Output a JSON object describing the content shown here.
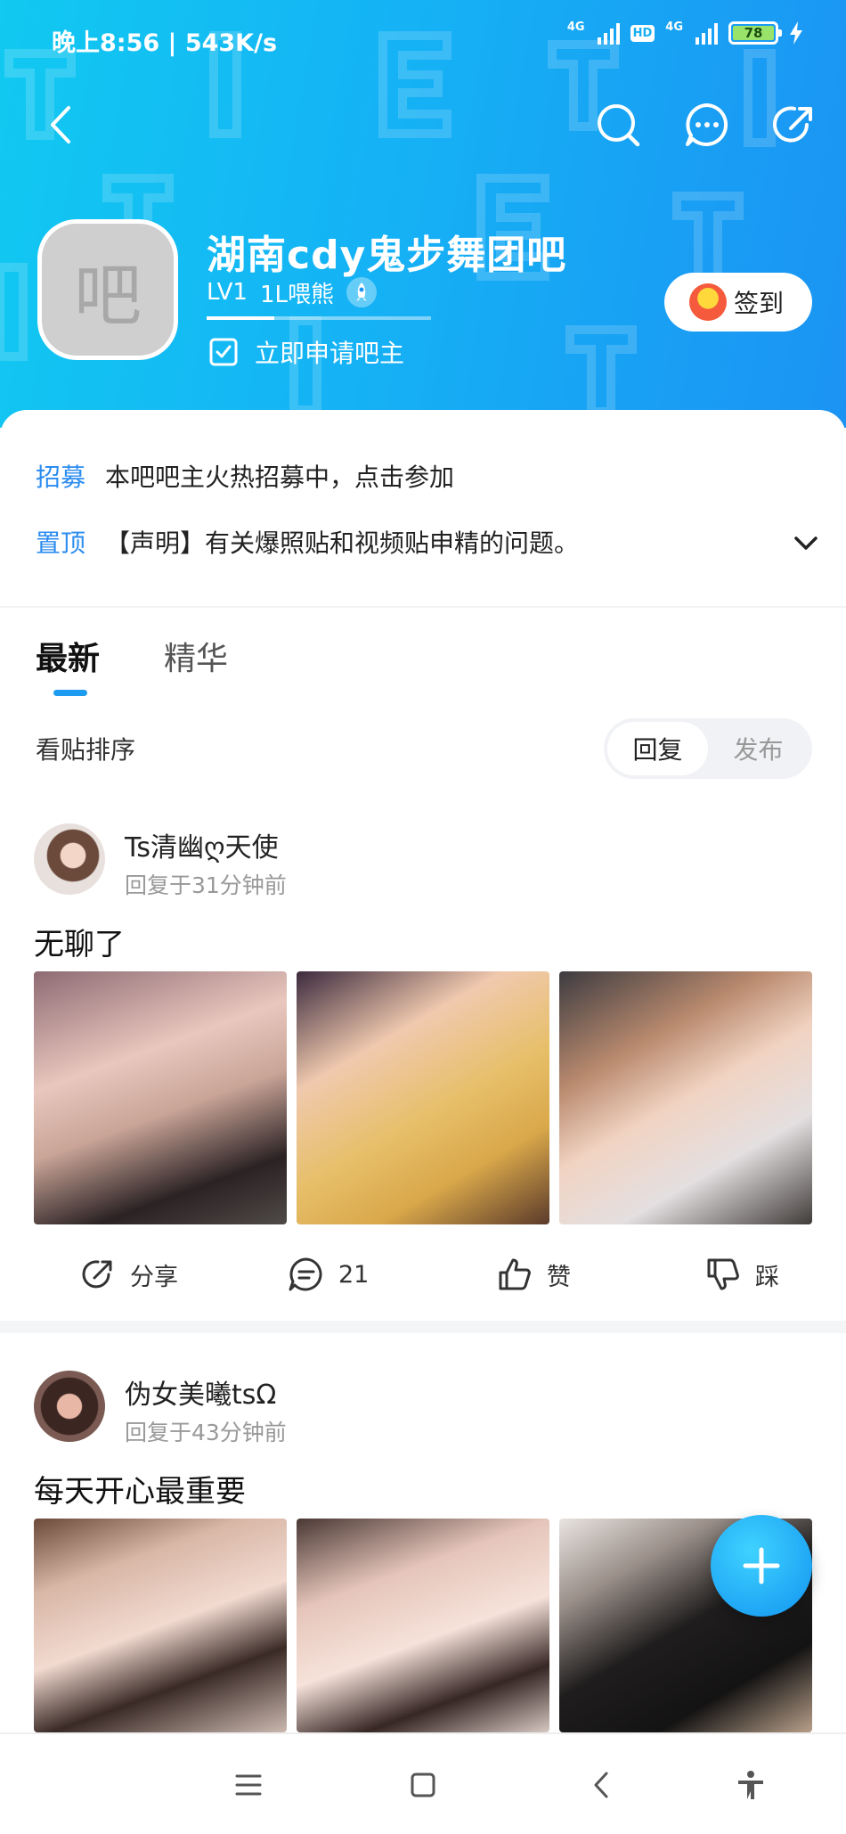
{
  "status_bar": {
    "time": "晚上8:56 | 543K/s",
    "network_1": "4G",
    "hd": "HD",
    "network_2": "4G",
    "battery": "78"
  },
  "header": {
    "forum_avatar_char": "吧",
    "forum_name": "湖南cdy鬼步舞团吧",
    "level": "LV1",
    "level_title": "1L喂熊",
    "apply_label": "立即申请吧主",
    "signin_label": "签到",
    "exp_progress": 0.3
  },
  "notices": [
    {
      "kind": "招募",
      "text": "本吧吧主火热招募中，点击参加"
    },
    {
      "kind": "置顶",
      "text": "【声明】有关爆照贴和视频贴申精的问题。"
    }
  ],
  "tabs": [
    {
      "label": "最新"
    },
    {
      "label": "精华"
    }
  ],
  "sort": {
    "label": "看贴排序",
    "options": [
      {
        "label": "回复"
      },
      {
        "label": "发布"
      }
    ],
    "selected": "回复"
  },
  "posts": [
    {
      "author": "Ts清幽ღ天使",
      "time": "回复于31分钟前",
      "title": "无聊了",
      "actions": {
        "share": "分享",
        "comments": "21",
        "like": "赞",
        "dislike": "踩"
      }
    },
    {
      "author": "伪女美曦tsΩ",
      "time": "回复于43分钟前",
      "title": "每天开心最重要"
    }
  ],
  "colors": {
    "accent": "#1d9bf0",
    "header_gradient_start": "#11c9f1",
    "header_gradient_end": "#1b93f3",
    "notice_kind": "#2b8cf0"
  },
  "icons": [
    "back-icon",
    "search-icon",
    "message-icon",
    "share-icon",
    "rocket-icon",
    "checkbox-icon",
    "chevron-down-icon",
    "plus-icon",
    "menu-icon",
    "home-icon",
    "nav-back-icon",
    "accessibility-icon"
  ]
}
